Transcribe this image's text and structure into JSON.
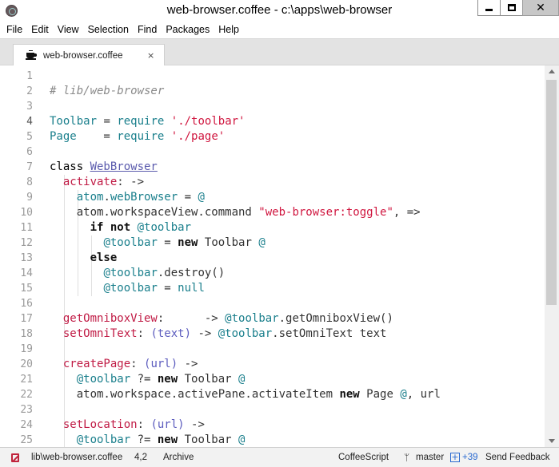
{
  "window": {
    "title": "web-browser.coffee - c:\\apps\\web-browser",
    "minimize_glyph": "—",
    "maximize_glyph": "□",
    "close_glyph": "✕"
  },
  "menu": [
    "File",
    "Edit",
    "View",
    "Selection",
    "Find",
    "Packages",
    "Help"
  ],
  "tab": {
    "label": "web-browser.coffee",
    "close_glyph": "×",
    "icon": "coffee-cup-icon"
  },
  "editor": {
    "current_line": 4,
    "line_numbers": [
      "1",
      "2",
      "3",
      "4",
      "5",
      "6",
      "7",
      "8",
      "9",
      "10",
      "11",
      "12",
      "13",
      "14",
      "15",
      "16",
      "17",
      "18",
      "19",
      "20",
      "21",
      "22",
      "23",
      "24",
      "25"
    ],
    "lines": [
      [],
      [
        {
          "t": "# lib/web-browser",
          "c": "c"
        }
      ],
      [],
      [
        {
          "t": "Toolbar",
          "c": "v"
        },
        {
          "t": " = ",
          "c": "op"
        },
        {
          "t": "require",
          "c": "v"
        },
        {
          "t": " ",
          "c": "p"
        },
        {
          "t": "'./toolbar'",
          "c": "s"
        }
      ],
      [
        {
          "t": "Page",
          "c": "v"
        },
        {
          "t": "    = ",
          "c": "op"
        },
        {
          "t": "require",
          "c": "v"
        },
        {
          "t": " ",
          "c": "p"
        },
        {
          "t": "'./page'",
          "c": "s"
        }
      ],
      [],
      [
        {
          "t": "class ",
          "c": "k"
        },
        {
          "t": "WebBrowser",
          "c": "cls"
        }
      ],
      [
        {
          "t": "  ",
          "c": "p"
        },
        {
          "t": "activate",
          "c": "fn"
        },
        {
          "t": ": ->",
          "c": "op"
        }
      ],
      [
        {
          "t": "    ",
          "c": "p"
        },
        {
          "t": "atom",
          "c": "v"
        },
        {
          "t": ".",
          "c": "p"
        },
        {
          "t": "webBrowser",
          "c": "v"
        },
        {
          "t": " = ",
          "c": "op"
        },
        {
          "t": "@",
          "c": "v"
        }
      ],
      [
        {
          "t": "    ",
          "c": "p"
        },
        {
          "t": "atom.workspaceView.command ",
          "c": "op"
        },
        {
          "t": "\"web-browser:toggle\"",
          "c": "s"
        },
        {
          "t": ", =>",
          "c": "op"
        }
      ],
      [
        {
          "t": "      ",
          "c": "p"
        },
        {
          "t": "if not ",
          "c": "kw"
        },
        {
          "t": "@toolbar",
          "c": "v"
        }
      ],
      [
        {
          "t": "        ",
          "c": "p"
        },
        {
          "t": "@toolbar",
          "c": "v"
        },
        {
          "t": " = ",
          "c": "op"
        },
        {
          "t": "new ",
          "c": "kw"
        },
        {
          "t": "Toolbar ",
          "c": "op"
        },
        {
          "t": "@",
          "c": "v"
        }
      ],
      [
        {
          "t": "      ",
          "c": "p"
        },
        {
          "t": "else",
          "c": "kw"
        }
      ],
      [
        {
          "t": "        ",
          "c": "p"
        },
        {
          "t": "@toolbar",
          "c": "v"
        },
        {
          "t": ".destroy()",
          "c": "op"
        }
      ],
      [
        {
          "t": "        ",
          "c": "p"
        },
        {
          "t": "@toolbar",
          "c": "v"
        },
        {
          "t": " = ",
          "c": "op"
        },
        {
          "t": "null",
          "c": "v"
        }
      ],
      [],
      [
        {
          "t": "  ",
          "c": "p"
        },
        {
          "t": "getOmniboxView",
          "c": "fn"
        },
        {
          "t": ":      -> ",
          "c": "op"
        },
        {
          "t": "@toolbar",
          "c": "v"
        },
        {
          "t": ".getOmniboxView()",
          "c": "op"
        }
      ],
      [
        {
          "t": "  ",
          "c": "p"
        },
        {
          "t": "setOmniText",
          "c": "fn"
        },
        {
          "t": ": ",
          "c": "op"
        },
        {
          "t": "(text)",
          "c": "arg"
        },
        {
          "t": " -> ",
          "c": "op"
        },
        {
          "t": "@toolbar",
          "c": "v"
        },
        {
          "t": ".setOmniText text",
          "c": "op"
        }
      ],
      [],
      [
        {
          "t": "  ",
          "c": "p"
        },
        {
          "t": "createPage",
          "c": "fn"
        },
        {
          "t": ": ",
          "c": "op"
        },
        {
          "t": "(url)",
          "c": "arg"
        },
        {
          "t": " ->",
          "c": "op"
        }
      ],
      [
        {
          "t": "    ",
          "c": "p"
        },
        {
          "t": "@toolbar",
          "c": "v"
        },
        {
          "t": " ?= ",
          "c": "op"
        },
        {
          "t": "new ",
          "c": "kw"
        },
        {
          "t": "Toolbar ",
          "c": "op"
        },
        {
          "t": "@",
          "c": "v"
        }
      ],
      [
        {
          "t": "    ",
          "c": "p"
        },
        {
          "t": "atom.workspace.activePane.activateItem ",
          "c": "op"
        },
        {
          "t": "new ",
          "c": "kw"
        },
        {
          "t": "Page ",
          "c": "op"
        },
        {
          "t": "@",
          "c": "v"
        },
        {
          "t": ", url",
          "c": "op"
        }
      ],
      [],
      [
        {
          "t": "  ",
          "c": "p"
        },
        {
          "t": "setLocation",
          "c": "fn"
        },
        {
          "t": ": ",
          "c": "op"
        },
        {
          "t": "(url)",
          "c": "arg"
        },
        {
          "t": " ->",
          "c": "op"
        }
      ],
      [
        {
          "t": "    ",
          "c": "p"
        },
        {
          "t": "@toolbar",
          "c": "v"
        },
        {
          "t": " ?= ",
          "c": "op"
        },
        {
          "t": "new ",
          "c": "kw"
        },
        {
          "t": "Toolbar ",
          "c": "op"
        },
        {
          "t": "@",
          "c": "v"
        }
      ]
    ]
  },
  "status": {
    "file_path": "lib\\web-browser.coffee",
    "cursor": "4,2",
    "archive": "Archive",
    "grammar": "CoffeeScript",
    "branch": "master",
    "diff": "+39",
    "feedback": "Send Feedback"
  }
}
